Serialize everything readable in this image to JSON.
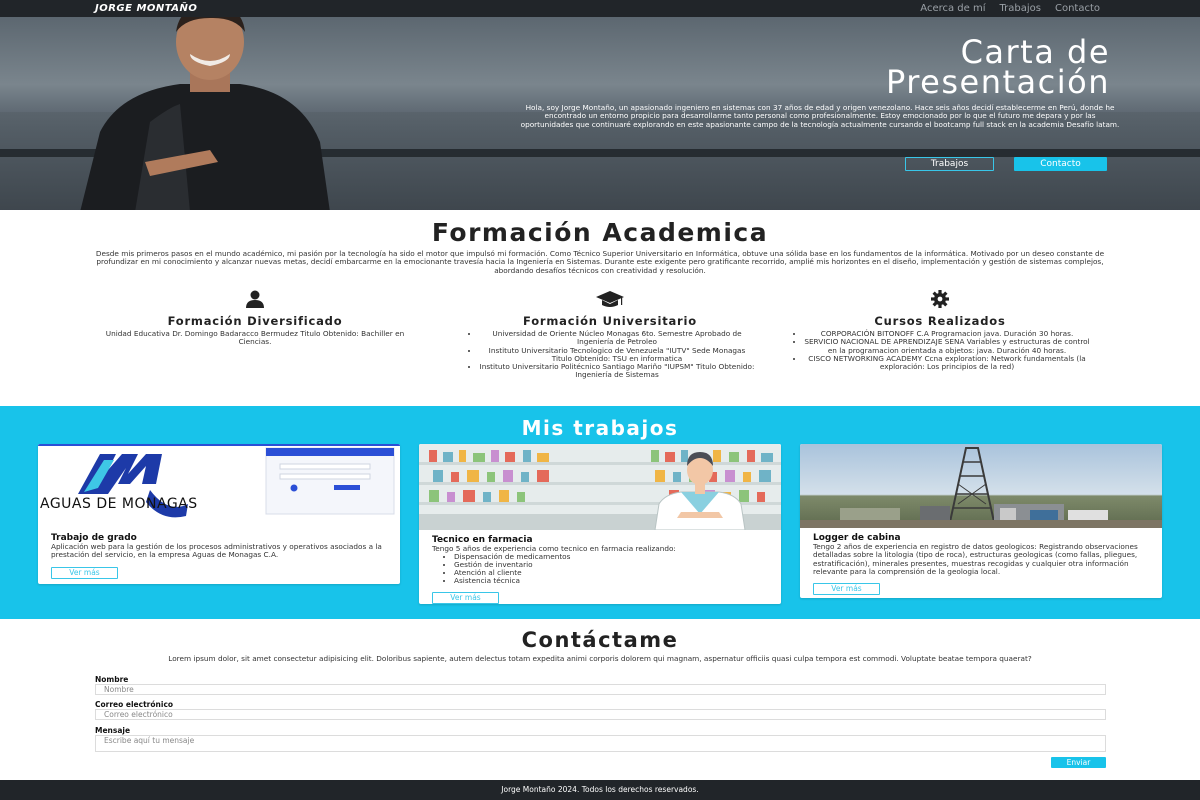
{
  "nav": {
    "brand": "JORGE MONTAÑO",
    "links": [
      "Acerca de mí",
      "Trabajos",
      "Contacto"
    ]
  },
  "hero": {
    "title_line1": "Carta de",
    "title_line2": "Presentación",
    "text": "Hola, soy Jorge Montaño, un apasionado ingeniero en sistemas con 37 años de edad y origen venezolano. Hace seis años decidí establecerme en Perú, donde he encontrado un entorno propicio para desarrollarme tanto personal como profesionalmente. Estoy emocionado por lo que el futuro me depara y por las oportunidades que continuaré explorando en este apasionante campo de la tecnología actualmente cursando el bootcamp full stack en la academia Desafío latam.",
    "btn_trabajos": "Trabajos",
    "btn_contacto": "Contacto"
  },
  "formacion": {
    "title": "Formación Academica",
    "intro": "Desde mis primeros pasos en el mundo académico, mi pasión por la tecnología ha sido el motor que impulsó mi formación. Como Técnico Superior Universitario en Informática, obtuve una sólida base en los fundamentos de la informática. Motivado por un deseo constante de profundizar en mi conocimiento y alcanzar nuevas metas, decidí embarcarme en la emocionante travesía hacia la Ingeniería en Sistemas. Durante este exigente pero gratificante recorrido, amplié mis horizontes en el diseño, implementación y gestión de sistemas complejos, abordando desafíos técnicos con creatividad y resolución.",
    "col1": {
      "title": "Formación Diversificado",
      "text": "Unidad Educativa Dr. Domingo Badaracco Bermudez Titulo Obtenido: Bachiller en Ciencias."
    },
    "col2": {
      "title": "Formación Universitario",
      "items": [
        "Universidad de Oriente Núcleo Monagas 6to. Semestre Aprobado de Ingeniería de Petroleo",
        "Instituto Universitario Tecnologico de Venezuela \"IUTV\" Sede Monagas Titulo Obtenido: TSU en informatica",
        "Instituto Universitario Politécnico Santiago Mariño \"IUPSM\" Titulo Obtenido: Ingeniería de Sistemas"
      ]
    },
    "col3": {
      "title": "Cursos Realizados",
      "items": [
        "CORPORACIÓN BITONOFF C.A Programacion java. Duración 30 horas.",
        "SERVICIO NACIONAL DE APRENDIZAJE SENA Variables y estructuras de control en la programacion orientada a objetos: java. Duración 40 horas.",
        "CISCO NETWORKING ACADEMY Ccna exploration: Network fundamentals (la exploración: Los principios de la red)"
      ]
    }
  },
  "trabajos": {
    "title": "Mis trabajos",
    "cards": [
      {
        "img_label": "AGUAS DE MONAGAS",
        "title": "Trabajo de grado",
        "text": "Aplicación web para la gestión de los procesos administrativos y operativos asociados a la prestación del servicio, en la empresa Aguas de Monagas C.A.",
        "btn": "Ver más"
      },
      {
        "title": "Tecnico en farmacia",
        "text": "Tengo 5 años de experiencia como tecnico en farmacia realizando:",
        "items": [
          "Dispensación de medicamentos",
          "Gestión de inventario",
          "Atención al cliente",
          "Asistencia técnica"
        ],
        "btn": "Ver más"
      },
      {
        "title": "Logger de cabina",
        "text": "Tengo 2 años de experiencia en registro de datos geologicos: Registrando observaciones detalladas sobre la litologia (tipo de roca), estructuras geologicas (como fallas, pliegues, estratificación), minerales presentes, muestras recogidas y cualquier otra información relevante para la comprensión de la geologia local.",
        "btn": "Ver más"
      }
    ]
  },
  "contacto": {
    "title": "Contáctame",
    "intro": "Lorem ipsum dolor, sit amet consectetur adipisicing elit. Doloribus sapiente, autem delectus totam expedita animi corporis dolorem qui magnam, aspernatur officiis quasi culpa tempora est commodi. Voluptate beatae tempora quaerat?",
    "nombre_label": "Nombre",
    "nombre_placeholder": "Nombre",
    "email_label": "Correo electrónico",
    "email_placeholder": "Correo electrónico",
    "mensaje_label": "Mensaje",
    "mensaje_placeholder": "Escribe aquí tu mensaje",
    "send": "Enviar"
  },
  "footer": "Jorge Montaño 2024. Todos los derechos reservados.",
  "colors": {
    "accent": "#18c3ea",
    "dark": "#212529"
  }
}
